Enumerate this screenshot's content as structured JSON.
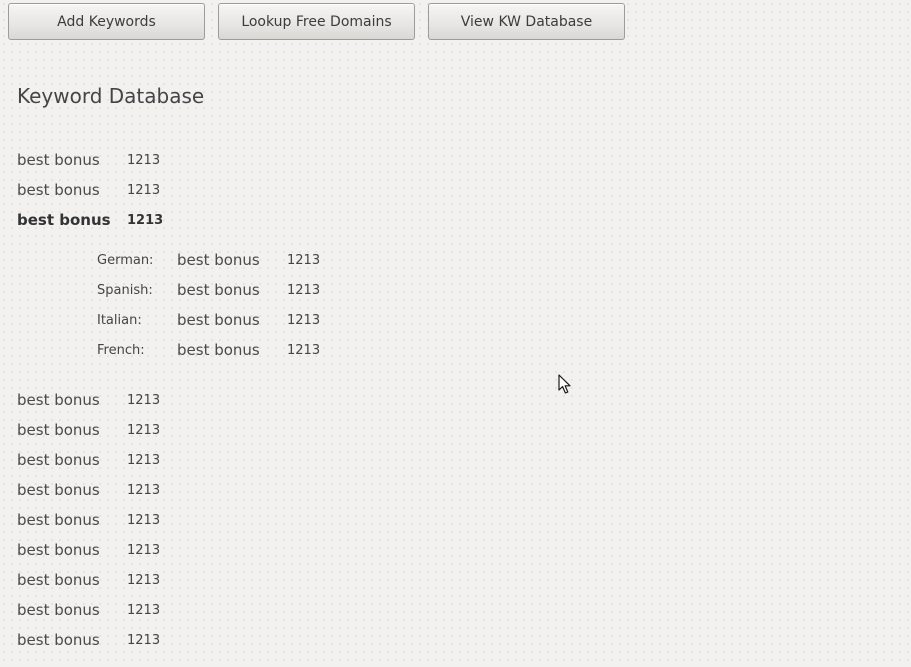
{
  "toolbar": {
    "add_keywords_label": "Add Keywords",
    "lookup_free_domains_label": "Lookup Free Domains",
    "view_kw_database_label": "View KW Database"
  },
  "page": {
    "title": "Keyword Database"
  },
  "keywords": [
    {
      "keyword": "best bonus",
      "volume": "1213",
      "selected": false
    },
    {
      "keyword": "best bonus",
      "volume": "1213",
      "selected": false
    },
    {
      "keyword": "best bonus",
      "volume": "1213",
      "selected": true
    },
    {
      "keyword": "best bonus",
      "volume": "1213",
      "selected": false
    },
    {
      "keyword": "best bonus",
      "volume": "1213",
      "selected": false
    },
    {
      "keyword": "best bonus",
      "volume": "1213",
      "selected": false
    },
    {
      "keyword": "best bonus",
      "volume": "1213",
      "selected": false
    },
    {
      "keyword": "best bonus",
      "volume": "1213",
      "selected": false
    },
    {
      "keyword": "best bonus",
      "volume": "1213",
      "selected": false
    },
    {
      "keyword": "best bonus",
      "volume": "1213",
      "selected": false
    },
    {
      "keyword": "best bonus",
      "volume": "1213",
      "selected": false
    },
    {
      "keyword": "best bonus",
      "volume": "1213",
      "selected": false
    }
  ],
  "translations": [
    {
      "language": "German:",
      "keyword": "best bonus",
      "volume": "1213"
    },
    {
      "language": "Spanish:",
      "keyword": "best bonus",
      "volume": "1213"
    },
    {
      "language": "Italian:",
      "keyword": "best bonus",
      "volume": "1213"
    },
    {
      "language": "French:",
      "keyword": "best bonus",
      "volume": "1213"
    }
  ],
  "icons": {
    "cursor": "mouse-pointer-icon"
  }
}
